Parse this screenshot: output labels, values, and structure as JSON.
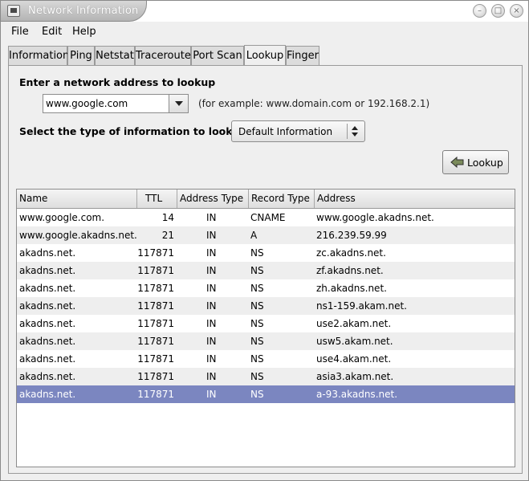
{
  "window": {
    "title": "Network Information"
  },
  "menu": [
    {
      "label": "File"
    },
    {
      "label": "Edit"
    },
    {
      "label": "Help"
    }
  ],
  "tabs": [
    {
      "label": "Information",
      "active": false
    },
    {
      "label": "Ping",
      "active": false
    },
    {
      "label": "Netstat",
      "active": false
    },
    {
      "label": "Traceroute",
      "active": false
    },
    {
      "label": "Port Scan",
      "active": false
    },
    {
      "label": "Lookup",
      "active": true
    },
    {
      "label": "Finger",
      "active": false
    }
  ],
  "lookup": {
    "address_label": "Enter a network address to lookup",
    "address_value": "www.google.com",
    "example_hint": "(for example: www.domain.com or 192.168.2.1)",
    "type_label": "Select the type of information to lookup:",
    "type_value": "Default Information",
    "button_label": "Lookup"
  },
  "table": {
    "columns": [
      "Name",
      "TTL",
      "Address Type",
      "Record Type",
      "Address"
    ],
    "rows": [
      [
        "www.google.com.",
        "14",
        "IN",
        "CNAME",
        "www.google.akadns.net."
      ],
      [
        "www.google.akadns.net.",
        "21",
        "IN",
        "A",
        "216.239.59.99"
      ],
      [
        "akadns.net.",
        "117871",
        "IN",
        "NS",
        "zc.akadns.net."
      ],
      [
        "akadns.net.",
        "117871",
        "IN",
        "NS",
        "zf.akadns.net."
      ],
      [
        "akadns.net.",
        "117871",
        "IN",
        "NS",
        "zh.akadns.net."
      ],
      [
        "akadns.net.",
        "117871",
        "IN",
        "NS",
        "ns1-159.akam.net."
      ],
      [
        "akadns.net.",
        "117871",
        "IN",
        "NS",
        "use2.akam.net."
      ],
      [
        "akadns.net.",
        "117871",
        "IN",
        "NS",
        "usw5.akam.net."
      ],
      [
        "akadns.net.",
        "117871",
        "IN",
        "NS",
        "use4.akam.net."
      ],
      [
        "akadns.net.",
        "117871",
        "IN",
        "NS",
        "asia3.akam.net."
      ],
      [
        "akadns.net.",
        "117871",
        "IN",
        "NS",
        "a-93.akadns.net."
      ]
    ],
    "selected_row": 10
  },
  "colors": {
    "selection": "#7b86c0",
    "alt_row": "#eeeeee"
  }
}
